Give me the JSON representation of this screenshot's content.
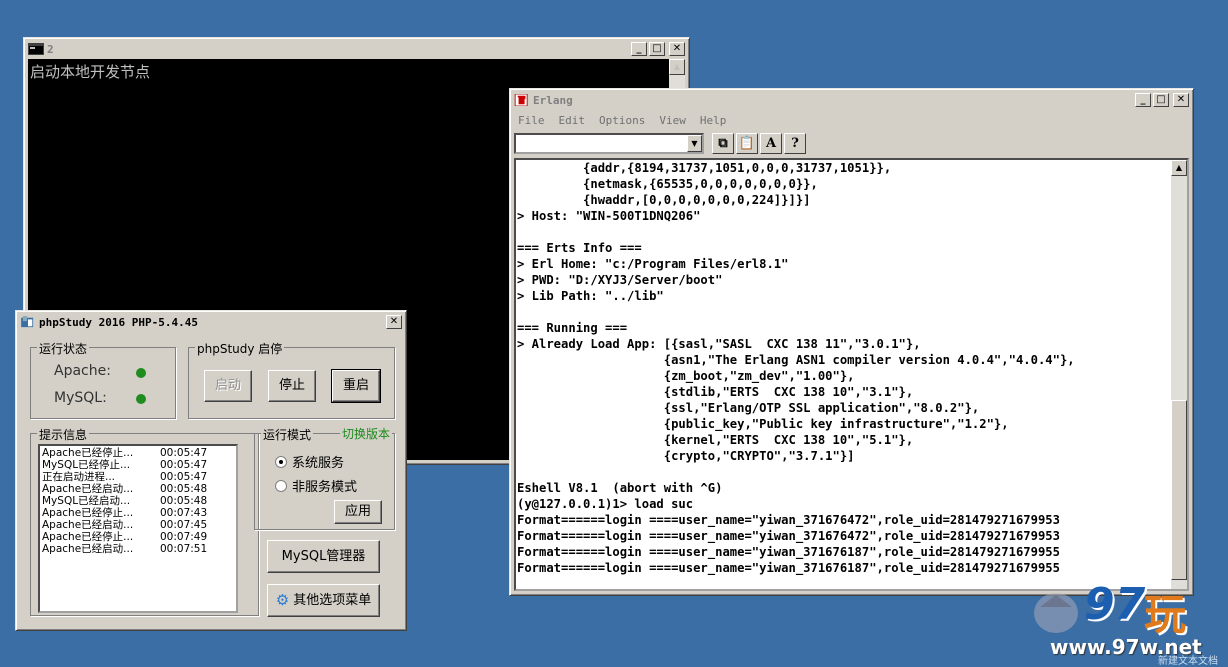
{
  "console": {
    "title": "2",
    "text": "启动本地开发节点"
  },
  "erlang": {
    "title": "Erlang",
    "menu": [
      "File",
      "Edit",
      "Options",
      "View",
      "Help"
    ],
    "lines": [
      "         {addr,{8194,31737,1051,0,0,0,31737,1051}},",
      "         {netmask,{65535,0,0,0,0,0,0,0}},",
      "         {hwaddr,[0,0,0,0,0,0,0,224]}]}]",
      "> Host: \"WIN-500T1DNQ206\"",
      "",
      "=== Erts Info ===",
      "> Erl Home: \"c:/Program Files/erl8.1\"",
      "> PWD: \"D:/XYJ3/Server/boot\"",
      "> Lib Path: \"../lib\"",
      "",
      "=== Running ===",
      "> Already Load App: [{sasl,\"SASL  CXC 138 11\",\"3.0.1\"},",
      "                    {asn1,\"The Erlang ASN1 compiler version 4.0.4\",\"4.0.4\"},",
      "                    {zm_boot,\"zm_dev\",\"1.00\"},",
      "                    {stdlib,\"ERTS  CXC 138 10\",\"3.1\"},",
      "                    {ssl,\"Erlang/OTP SSL application\",\"8.0.2\"},",
      "                    {public_key,\"Public key infrastructure\",\"1.2\"},",
      "                    {kernel,\"ERTS  CXC 138 10\",\"5.1\"},",
      "                    {crypto,\"CRYPTO\",\"3.7.1\"}]",
      "",
      "Eshell V8.1  (abort with ^G)",
      "(y@127.0.0.1)1> load suc",
      "Format======login ====user_name=\"yiwan_371676472\",role_uid=281479271679953",
      "Format======login ====user_name=\"yiwan_371676472\",role_uid=281479271679953",
      "Format======login ====user_name=\"yiwan_371676187\",role_uid=281479271679955",
      "Format======login ====user_name=\"yiwan_371676187\",role_uid=281479271679955"
    ]
  },
  "php": {
    "title": "phpStudy 2016    PHP-5.4.45",
    "status_group": "运行状态",
    "apache_label": "Apache:",
    "mysql_label": "MySQL:",
    "control_group": "phpStudy 启停",
    "start": "启动",
    "stop": "停止",
    "restart": "重启",
    "log_group": "提示信息",
    "log": [
      {
        "msg": "Apache已经停止...",
        "time": "00:05:47"
      },
      {
        "msg": "MySQL已经停止...",
        "time": "00:05:47"
      },
      {
        "msg": "正在启动进程...",
        "time": "00:05:47"
      },
      {
        "msg": "Apache已经启动...",
        "time": "00:05:48"
      },
      {
        "msg": "MySQL已经启动...",
        "time": "00:05:48"
      },
      {
        "msg": "Apache已经停止...",
        "time": "00:07:43"
      },
      {
        "msg": "Apache已经启动...",
        "time": "00:07:45"
      },
      {
        "msg": "Apache已经停止...",
        "time": "00:07:49"
      },
      {
        "msg": "Apache已经启动...",
        "time": "00:07:51"
      }
    ],
    "mode_group": "运行模式",
    "switch_version": "切换版本",
    "mode_service": "系统服务",
    "mode_nonservice": "非服务模式",
    "apply": "应用",
    "mysql_manager": "MySQL管理器",
    "other_menu": "其他选项菜单",
    "colors": {
      "running": "#1e8c1e",
      "switch_link": "#1a8a1a"
    }
  },
  "watermark": {
    "brand": "97",
    "char": "玩",
    "url": "www.97w.net",
    "corner": "新建文本文档"
  }
}
